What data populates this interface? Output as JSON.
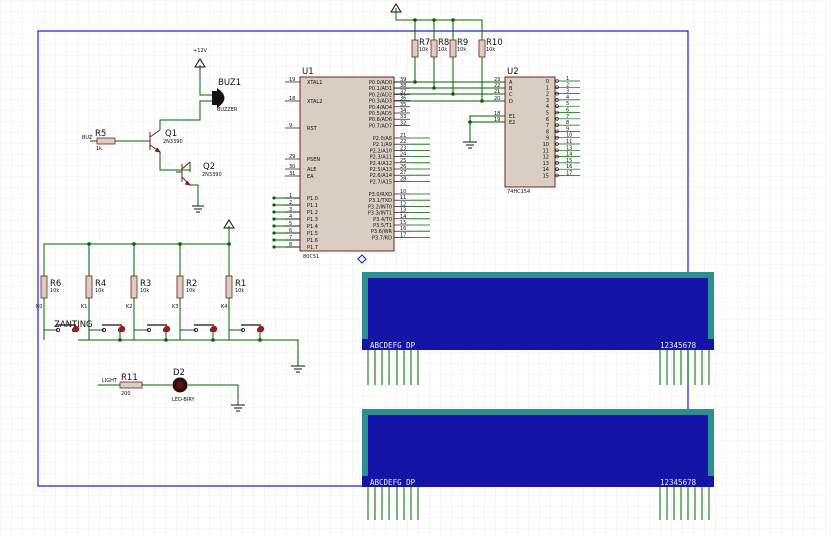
{
  "power": {
    "vcc_label": "+12V"
  },
  "buzzer": {
    "ref": "BUZ1",
    "part": "BUZZER"
  },
  "transistors": [
    {
      "ref": "Q1",
      "part": "2N3390"
    },
    {
      "ref": "Q2",
      "part": "2N3390"
    }
  ],
  "resistors": {
    "r5": {
      "ref": "R5",
      "value": "1k",
      "net": "BUZ"
    },
    "r11": {
      "ref": "R11",
      "value": "200",
      "net": "LIGHT"
    },
    "pullups": [
      {
        "ref": "R7",
        "value": "10k"
      },
      {
        "ref": "R8",
        "value": "10k"
      },
      {
        "ref": "R9",
        "value": "10k"
      },
      {
        "ref": "R10",
        "value": "10k"
      }
    ],
    "keys": [
      {
        "ref": "R6",
        "value": "10k",
        "net": "K0"
      },
      {
        "ref": "R4",
        "value": "10k",
        "net": "K1"
      },
      {
        "ref": "R3",
        "value": "10k",
        "net": "K2"
      },
      {
        "ref": "R2",
        "value": "10k",
        "net": "K3"
      },
      {
        "ref": "R1",
        "value": "10k",
        "net": "K4"
      }
    ]
  },
  "switch": {
    "label": "ZANTING"
  },
  "led": {
    "ref": "D2",
    "part": "LED-BIRY"
  },
  "mcu": {
    "ref": "U1",
    "part": "80C51",
    "left_pins": [
      {
        "num": "19",
        "name": "XTAL1"
      },
      {
        "num": "18",
        "name": "XTAL2"
      },
      {
        "num": "9",
        "name": "RST"
      },
      {
        "num": "29",
        "name": "PSEN"
      },
      {
        "num": "30",
        "name": "ALE"
      },
      {
        "num": "31",
        "name": "EA"
      },
      {
        "num": "1",
        "name": "P1.0"
      },
      {
        "num": "2",
        "name": "P1.1"
      },
      {
        "num": "3",
        "name": "P1.2"
      },
      {
        "num": "4",
        "name": "P1.3"
      },
      {
        "num": "5",
        "name": "P1.4"
      },
      {
        "num": "6",
        "name": "P1.5"
      },
      {
        "num": "7",
        "name": "P1.6"
      },
      {
        "num": "8",
        "name": "P1.7"
      }
    ],
    "right_pins": [
      {
        "num": "39",
        "name": "P0.0/AD0"
      },
      {
        "num": "38",
        "name": "P0.1/AD1"
      },
      {
        "num": "37",
        "name": "P0.2/AD2"
      },
      {
        "num": "36",
        "name": "P0.3/AD3"
      },
      {
        "num": "35",
        "name": "P0.4/AD4"
      },
      {
        "num": "34",
        "name": "P0.5/AD5"
      },
      {
        "num": "33",
        "name": "P0.6/AD6"
      },
      {
        "num": "32",
        "name": "P0.7/AD7"
      },
      {
        "num": "21",
        "name": "P2.0/A8"
      },
      {
        "num": "22",
        "name": "P2.1/A9"
      },
      {
        "num": "23",
        "name": "P2.2/A10"
      },
      {
        "num": "24",
        "name": "P2.3/A11"
      },
      {
        "num": "25",
        "name": "P2.4/A12"
      },
      {
        "num": "26",
        "name": "P2.5/A13"
      },
      {
        "num": "27",
        "name": "P2.6/A14"
      },
      {
        "num": "28",
        "name": "P2.7/A15"
      },
      {
        "num": "10",
        "name": "P3.0/RXD"
      },
      {
        "num": "11",
        "name": "P3.1/TXD"
      },
      {
        "num": "12",
        "name": "P3.2/INT0"
      },
      {
        "num": "13",
        "name": "P3.3/INT1"
      },
      {
        "num": "14",
        "name": "P3.4/T0"
      },
      {
        "num": "15",
        "name": "P3.5/T1"
      },
      {
        "num": "16",
        "name": "P3.6/WR"
      },
      {
        "num": "17",
        "name": "P3.7/RD"
      }
    ]
  },
  "decoder": {
    "ref": "U2",
    "part": "74HC154",
    "inputs": [
      {
        "num": "23",
        "name": "A"
      },
      {
        "num": "22",
        "name": "B"
      },
      {
        "num": "21",
        "name": "C"
      },
      {
        "num": "20",
        "name": "D"
      },
      {
        "num": "18",
        "name": "E1"
      },
      {
        "num": "19",
        "name": "E2"
      }
    ],
    "outputs": [
      {
        "num": "1",
        "name": "0"
      },
      {
        "num": "2",
        "name": "1"
      },
      {
        "num": "3",
        "name": "2"
      },
      {
        "num": "4",
        "name": "3"
      },
      {
        "num": "5",
        "name": "4"
      },
      {
        "num": "6",
        "name": "5"
      },
      {
        "num": "7",
        "name": "6"
      },
      {
        "num": "8",
        "name": "7"
      },
      {
        "num": "9",
        "name": "8"
      },
      {
        "num": "10",
        "name": "9"
      },
      {
        "num": "11",
        "name": "10"
      },
      {
        "num": "13",
        "name": "11"
      },
      {
        "num": "14",
        "name": "12"
      },
      {
        "num": "15",
        "name": "13"
      },
      {
        "num": "16",
        "name": "14"
      },
      {
        "num": "17",
        "name": "15"
      }
    ]
  },
  "displays": [
    {
      "seg_label": "ABCDEFG DP",
      "digit_label": "12345678"
    },
    {
      "seg_label": "ABCDEFG DP",
      "digit_label": "12345678"
    }
  ],
  "colors": {
    "wire": "#006400",
    "body": "#d8cfc2",
    "outline": "#7a1e1e",
    "lcd_bezel": "#2f8f8f",
    "lcd_screen": "#1414a8",
    "grid": "#e2e2e2",
    "frame": "#1a1acc"
  }
}
